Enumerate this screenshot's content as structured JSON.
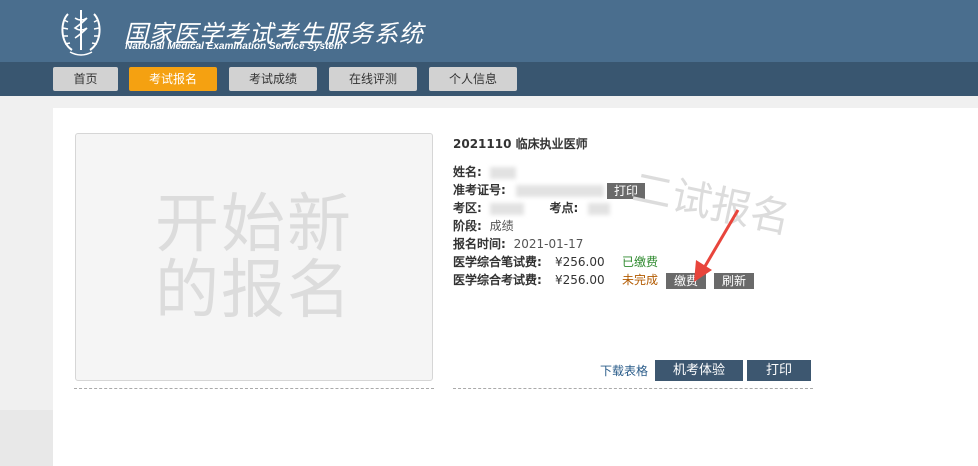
{
  "header": {
    "title": "国家医学考试考生服务系统",
    "subtitle": "National Medical Examination Service System",
    "logo_icon": "medical-emblem-icon"
  },
  "nav": {
    "items": [
      {
        "label": "首页"
      },
      {
        "label": "考试报名"
      },
      {
        "label": "考试成绩"
      },
      {
        "label": "在线评测"
      },
      {
        "label": "个人信息"
      }
    ],
    "active_index": 1,
    "active_color": "#f5a111"
  },
  "new_registration": {
    "line1": "开始新",
    "line2": "的报名"
  },
  "exam": {
    "title": "2021110 临床执业医师",
    "name_label": "姓名:",
    "ticket_label": "准考证号:",
    "print_small": "打印",
    "district_label": "考区:",
    "site_label": "考点:",
    "stage_label": "阶段:",
    "stage_value": "成绩",
    "reg_time_label": "报名时间:",
    "reg_time_value": "2021-01-17",
    "fee1_label": "医学综合笔试费:",
    "fee1_amount": "¥256.00",
    "fee1_status": "已缴费",
    "fee2_label": "医学综合考试费:",
    "fee2_amount": "¥256.00",
    "fee2_status": "未完成",
    "pay_button": "缴费",
    "refresh_button": "刷新"
  },
  "watermark": "二试报名",
  "actions": {
    "download_link": "下载表格",
    "trial_button": "机考体验",
    "print_button": "打印"
  },
  "colors": {
    "header_bg": "#4a6e8e",
    "nav_bg": "#395670",
    "paid": "#2f8a2f",
    "unpaid": "#b25a00",
    "arrow": "#e8453c"
  }
}
